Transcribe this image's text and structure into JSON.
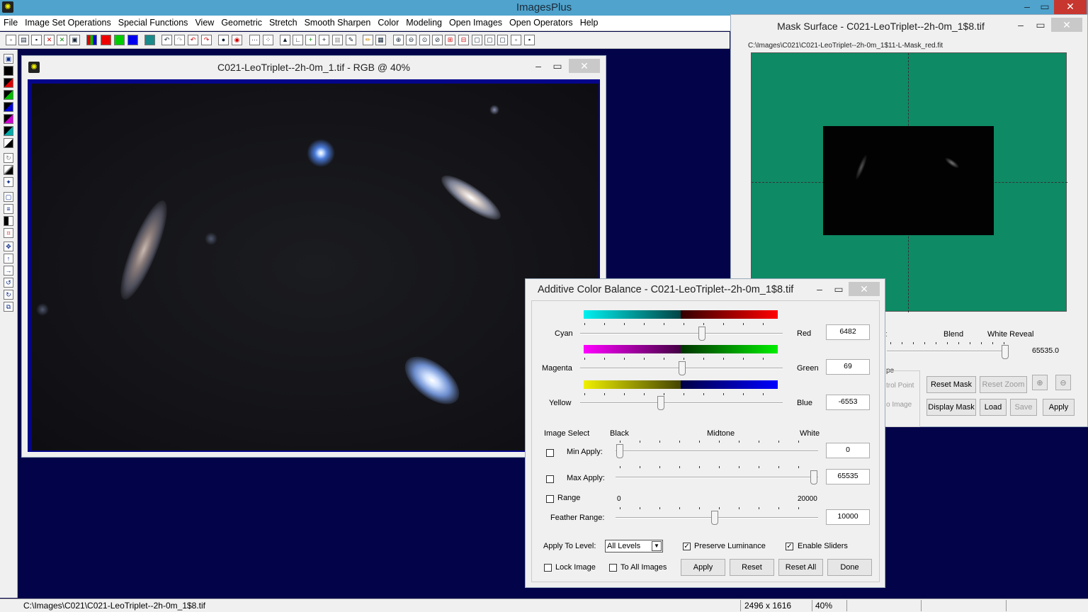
{
  "app": {
    "title": "ImagesPlus"
  },
  "menu": [
    "File",
    "Image Set Operations",
    "Special Functions",
    "View",
    "Geometric",
    "Stretch",
    "Smooth Sharpen",
    "Color",
    "Modeling",
    "Open Images",
    "Open Operators",
    "Help"
  ],
  "image_window": {
    "title": "C021-LeoTriplet--2h-0m_1.tif - RGB @ 40%"
  },
  "mask_window": {
    "title": "Mask Surface - C021-LeoTriplet--2h-0m_1$8.tif",
    "path": "C:\\Images\\C021\\C021-LeoTriplet--2h-0m_1$11-L-Mask_red.fit",
    "blend_label": "Blend",
    "white_reveal_label": "White Reveal",
    "white_reveal_value": "65535.0",
    "partial_type": "pe",
    "partial_control_point": "trol Point",
    "partial_image": "o Image",
    "partial_left": ":",
    "buttons": {
      "reset_mask": "Reset Mask",
      "reset_zoom": "Reset Zoom",
      "display_mask": "Display Mask",
      "load": "Load",
      "save": "Save",
      "apply": "Apply"
    }
  },
  "color_balance": {
    "title": "Additive Color Balance - C021-LeoTriplet--2h-0m_1$8.tif",
    "rows": [
      {
        "left": "Cyan",
        "right": "Red",
        "value": "6482",
        "level": 0.6
      },
      {
        "left": "Magenta",
        "right": "Green",
        "value": "69",
        "level": 0.505
      },
      {
        "left": "Yellow",
        "right": "Blue",
        "value": "-6553",
        "level": 0.4
      }
    ],
    "image_select_label": "Image Select",
    "black_label": "Black",
    "midtone_label": "Midtone",
    "white_label": "White",
    "min_apply_label": "Min Apply:",
    "min_apply_value": "0",
    "max_apply_label": "Max Apply:",
    "max_apply_value": "65535",
    "range_label": "Range",
    "range_min": "0",
    "range_max": "20000",
    "feather_label": "Feather Range:",
    "feather_value": "10000",
    "apply_to_level_label": "Apply To Level:",
    "apply_to_level_value": "All Levels",
    "preserve_luminance_label": "Preserve Luminance",
    "enable_sliders_label": "Enable Sliders",
    "lock_image_label": "Lock Image",
    "to_all_images_label": "To All Images",
    "buttons": {
      "apply": "Apply",
      "reset": "Reset",
      "reset_all": "Reset All",
      "done": "Done"
    }
  },
  "status": {
    "path": "C:\\Images\\C021\\C021-LeoTriplet--2h-0m_1$8.tif",
    "dimensions": "2496 x 1616",
    "zoom": "40%"
  }
}
